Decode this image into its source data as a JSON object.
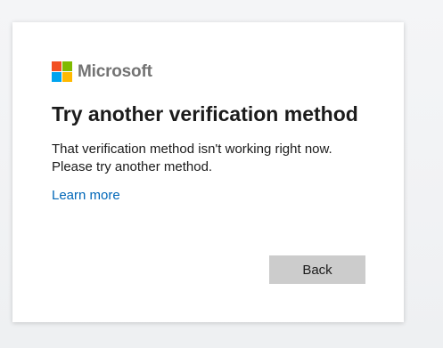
{
  "brand": {
    "name": "Microsoft",
    "logo_icon": "microsoft-four-squares-logo",
    "colors": [
      "#f25022",
      "#7fba00",
      "#00a4ef",
      "#ffb900"
    ]
  },
  "dialog": {
    "title": "Try another verification method",
    "message_line1": "That verification method isn't working right now.",
    "message_line2": "Please try another method.",
    "link_label": "Learn more",
    "back_button_label": "Back"
  },
  "colors": {
    "link": "#0067b8",
    "button_bg": "#cccccc",
    "text": "#1b1b1b",
    "brand_text": "#737373"
  }
}
